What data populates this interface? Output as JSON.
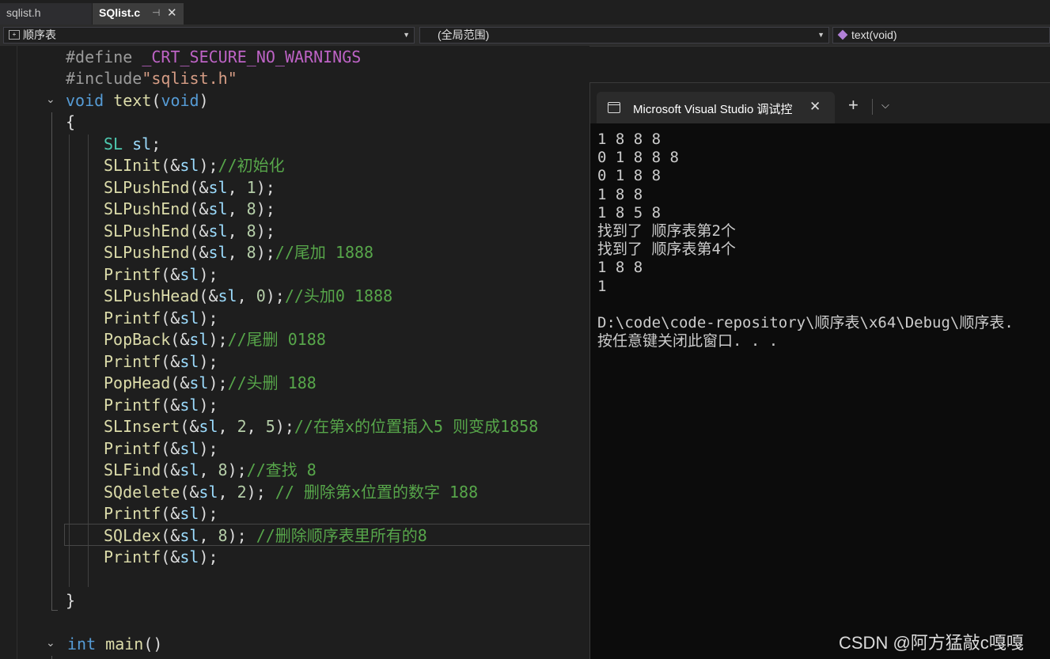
{
  "tabs": [
    {
      "label": "sqlist.h",
      "active": false
    },
    {
      "label": "SQlist.c",
      "active": true
    }
  ],
  "nav": {
    "project": "顺序表",
    "scope": "(全局范围)",
    "member": "text(void)"
  },
  "code": {
    "l1a": "#define ",
    "l1b": "_CRT_SECURE_NO_WARNINGS",
    "l2a": "#include",
    "l2b": "\"sqlist.h\"",
    "l3a": "void ",
    "l3b": "text",
    "l3c": "(",
    "l3d": "void",
    "l3e": ")",
    "l4": "{",
    "l5a": "SL ",
    "l5b": "sl",
    "l5c": ";",
    "l6a": "SLInit",
    "l6b": "(&",
    "l6c": "sl",
    "l6d": ");",
    "l6e": "//初始化",
    "l7a": "SLPushEnd",
    "l7b": "(&",
    "l7c": "sl",
    "l7d": ", ",
    "l7e": "1",
    "l7f": ");",
    "l8a": "SLPushEnd",
    "l8b": "(&",
    "l8c": "sl",
    "l8d": ", ",
    "l8e": "8",
    "l8f": ");",
    "l9a": "SLPushEnd",
    "l9b": "(&",
    "l9c": "sl",
    "l9d": ", ",
    "l9e": "8",
    "l9f": ");",
    "l10a": "SLPushEnd",
    "l10b": "(&",
    "l10c": "sl",
    "l10d": ", ",
    "l10e": "8",
    "l10f": ");",
    "l10g": "//尾加 1888",
    "l11a": "Printf",
    "l11b": "(&",
    "l11c": "sl",
    "l11d": ");",
    "l12a": "SLPushHead",
    "l12b": "(&",
    "l12c": "sl",
    "l12d": ", ",
    "l12e": "0",
    "l12f": ");",
    "l12g": "//头加0 1888",
    "l13a": "Printf",
    "l13b": "(&",
    "l13c": "sl",
    "l13d": ");",
    "l14a": "PopBack",
    "l14b": "(&",
    "l14c": "sl",
    "l14d": ");",
    "l14e": "//尾删 0188",
    "l15a": "Printf",
    "l15b": "(&",
    "l15c": "sl",
    "l15d": ");",
    "l16a": "PopHead",
    "l16b": "(&",
    "l16c": "sl",
    "l16d": ");",
    "l16e": "//头删 188",
    "l17a": "Printf",
    "l17b": "(&",
    "l17c": "sl",
    "l17d": ");",
    "l18a": "SLInsert",
    "l18b": "(&",
    "l18c": "sl",
    "l18d": ", ",
    "l18e": "2",
    "l18f": ", ",
    "l18g": "5",
    "l18h": ");",
    "l18i": "//在第x的位置插入5 则变成1858",
    "l19a": "Printf",
    "l19b": "(&",
    "l19c": "sl",
    "l19d": ");",
    "l20a": "SLFind",
    "l20b": "(&",
    "l20c": "sl",
    "l20d": ", ",
    "l20e": "8",
    "l20f": ");",
    "l20g": "//查找 8",
    "l21a": "SQdelete",
    "l21b": "(&",
    "l21c": "sl",
    "l21d": ", ",
    "l21e": "2",
    "l21f": "); ",
    "l21g": "// 删除第x位置的数字 188",
    "l22a": "Printf",
    "l22b": "(&",
    "l22c": "sl",
    "l22d": ");",
    "l23a": "SQLdex",
    "l23b": "(&",
    "l23c": "sl",
    "l23d": ", ",
    "l23e": "8",
    "l23f": "); ",
    "l23g": "//删除顺序表里所有的8",
    "l24a": "Printf",
    "l24b": "(&",
    "l24c": "sl",
    "l24d": ");",
    "l25": "}",
    "l26a": "int ",
    "l26b": "main",
    "l26c": "()"
  },
  "console": {
    "title": "Microsoft Visual Studio 调试控",
    "lines": [
      "1 8 8 8",
      "0 1 8 8 8",
      "0 1 8 8",
      "1 8 8",
      "1 8 5 8",
      "找到了 顺序表第2个",
      "找到了 顺序表第4个",
      "1 8 8",
      "1",
      "",
      "D:\\code\\code-repository\\顺序表\\x64\\Debug\\顺序表.",
      "按任意键关闭此窗口. . ."
    ]
  },
  "watermark": "CSDN @阿方猛敲c嘎嘎",
  "colors": {
    "editor_bg": "#1e1e1e",
    "console_bg": "#0c0c0c",
    "keyword": "#569cd6",
    "function": "#dcdcaa",
    "type": "#4ec9b0",
    "comment": "#57a64a",
    "number": "#b5cea8"
  }
}
